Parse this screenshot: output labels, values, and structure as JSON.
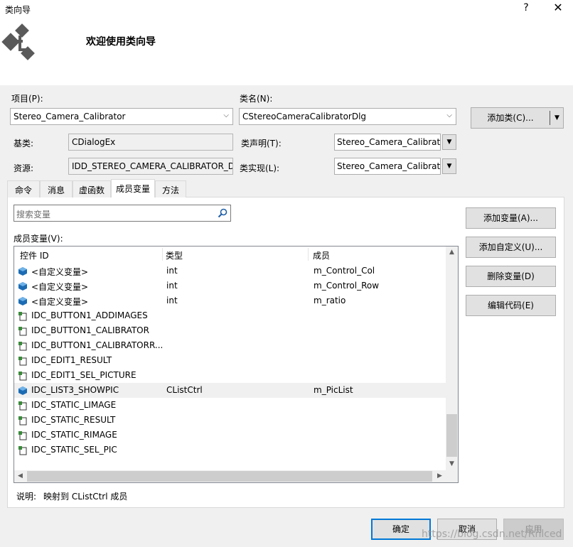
{
  "window": {
    "title": "类向导",
    "help_glyph": "?",
    "close_glyph": "✕"
  },
  "header": {
    "welcome": "欢迎使用类向导",
    "logo_icon": "class-wizard-logo-icon"
  },
  "fields": {
    "project_label": "项目(P):",
    "project_value": "Stereo_Camera_Calibrator",
    "classname_label": "类名(N):",
    "classname_value": "CStereoCameraCalibratorDlg",
    "add_class_label": "添加类(C)...",
    "base_label": "基类:",
    "base_value": "CDialogEx",
    "resource_label": "资源:",
    "resource_value": "IDD_STEREO_CAMERA_CALIBRATOR_DI",
    "class_decl_label": "类声明(T):",
    "class_decl_value": "Stereo_Camera_Calibrato",
    "class_impl_label": "类实现(L):",
    "class_impl_value": "Stereo_Camera_Calibrato"
  },
  "tabs": [
    {
      "label": "命令"
    },
    {
      "label": "消息"
    },
    {
      "label": "虚函数"
    },
    {
      "label": "成员变量",
      "active": true
    },
    {
      "label": "方法"
    }
  ],
  "search": {
    "placeholder": "搜索变量"
  },
  "member_list": {
    "label": "成员变量(V):",
    "columns": [
      "控件 ID",
      "类型",
      "成员"
    ],
    "rows": [
      {
        "id": "<自定义变量>",
        "type": "int",
        "member": "m_Control_Col",
        "icon": "variable-icon"
      },
      {
        "id": "<自定义变量>",
        "type": "int",
        "member": "m_Control_Row",
        "icon": "variable-icon"
      },
      {
        "id": "<自定义变量>",
        "type": "int",
        "member": "m_ratio",
        "icon": "variable-icon"
      },
      {
        "id": "IDC_BUTTON1_ADDIMAGES",
        "type": "",
        "member": "",
        "icon": "control-icon"
      },
      {
        "id": "IDC_BUTTON1_CALIBRATOR",
        "type": "",
        "member": "",
        "icon": "control-icon"
      },
      {
        "id": "IDC_BUTTON1_CALIBRATORR...",
        "type": "",
        "member": "",
        "icon": "control-icon"
      },
      {
        "id": "IDC_EDIT1_RESULT",
        "type": "",
        "member": "",
        "icon": "control-icon"
      },
      {
        "id": "IDC_EDIT1_SEL_PICTURE",
        "type": "",
        "member": "",
        "icon": "control-icon"
      },
      {
        "id": "IDC_LIST3_SHOWPIC",
        "type": "CListCtrl",
        "member": "m_PicList",
        "icon": "variable-icon",
        "selected": true
      },
      {
        "id": "IDC_STATIC_LIMAGE",
        "type": "",
        "member": "",
        "icon": "control-icon"
      },
      {
        "id": "IDC_STATIC_RESULT",
        "type": "",
        "member": "",
        "icon": "control-icon"
      },
      {
        "id": "IDC_STATIC_RIMAGE",
        "type": "",
        "member": "",
        "icon": "control-icon"
      },
      {
        "id": "IDC_STATIC_SEL_PIC",
        "type": "",
        "member": "",
        "icon": "control-icon"
      }
    ]
  },
  "side_buttons": {
    "add_variable": "添加变量(A)...",
    "add_custom": "添加自定义(U)...",
    "delete_variable": "删除变量(D)",
    "edit_code": "编辑代码(E)"
  },
  "description": {
    "label": "说明:",
    "value": "映射到 CListCtrl 成员"
  },
  "footer": {
    "ok": "确定",
    "cancel": "取消",
    "apply": "应用",
    "watermark": "https://blog.csdn.net/Rnlced"
  },
  "colors": {
    "accent": "#0078d7",
    "variable_icon": "#1c6cb4",
    "control_icon": "#3a8a3a"
  }
}
